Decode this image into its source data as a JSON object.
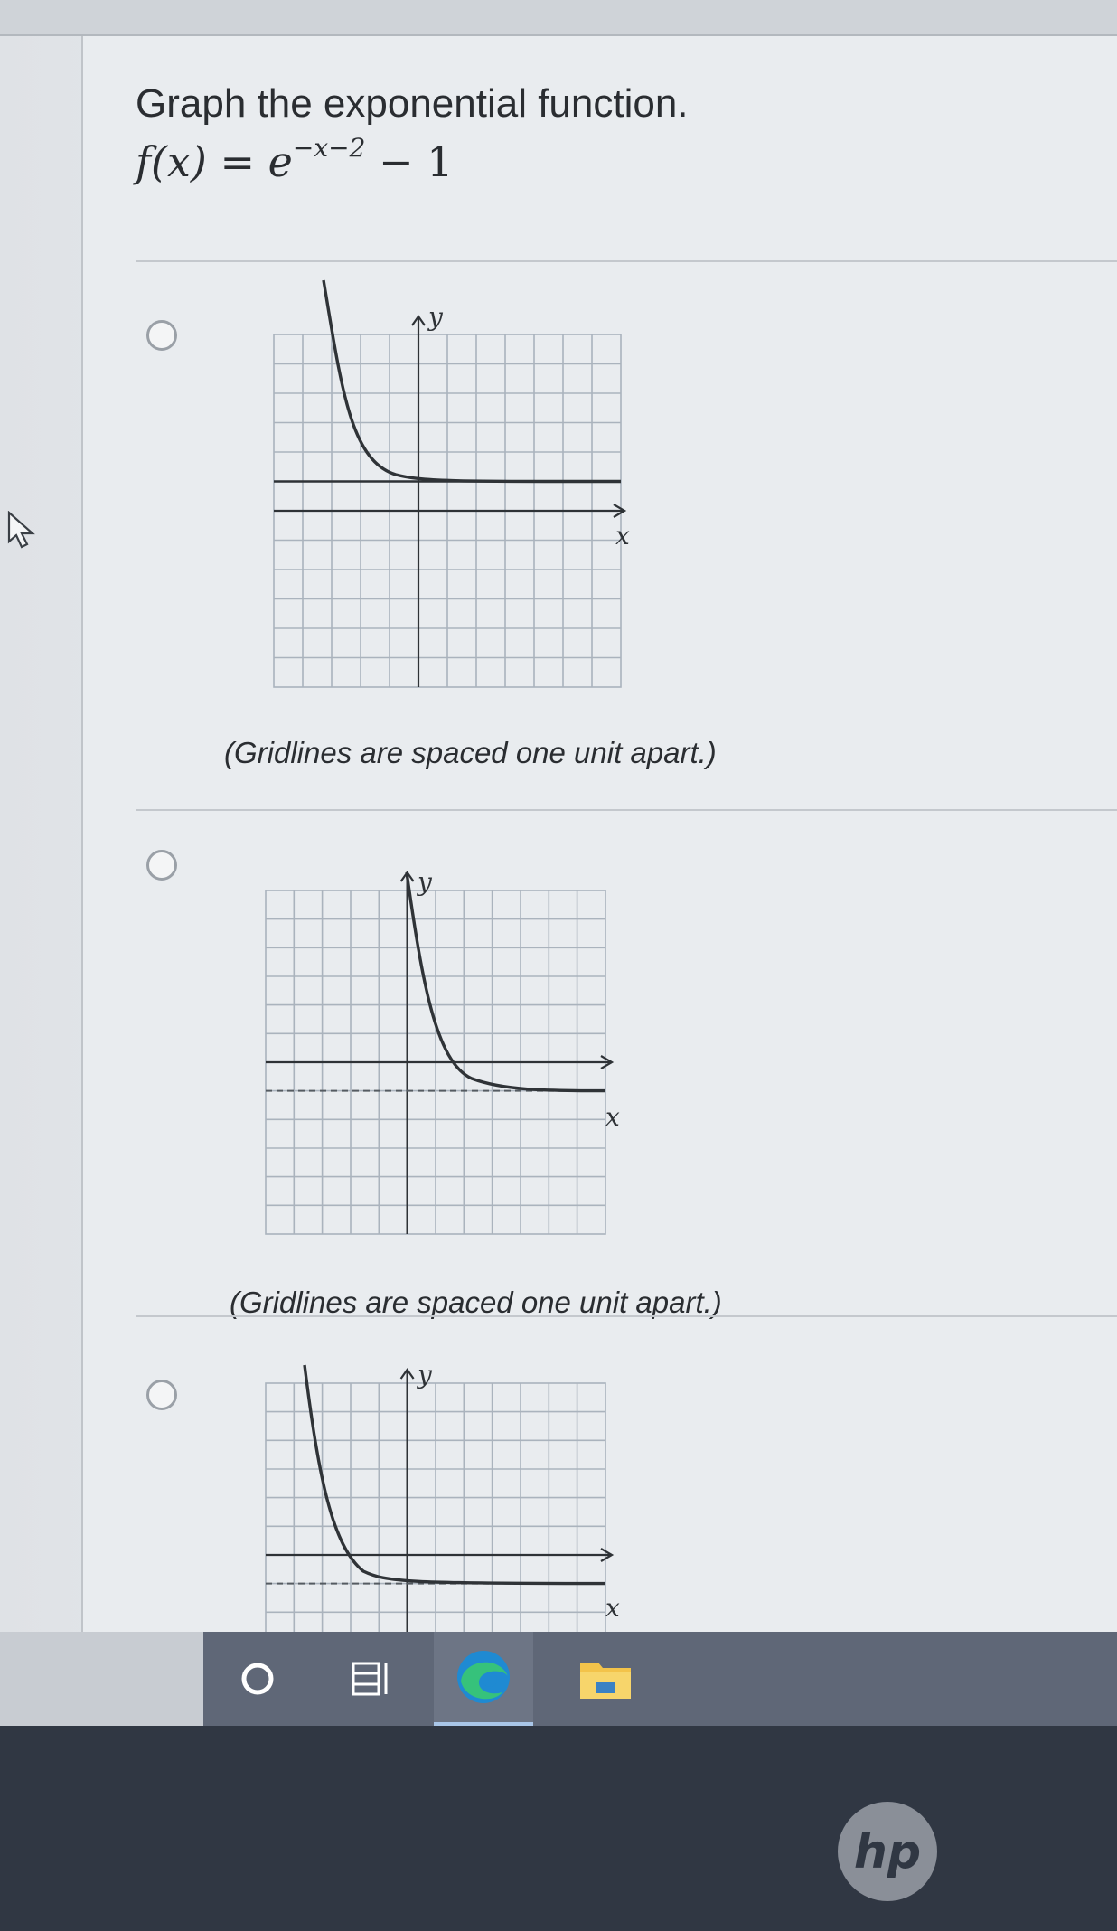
{
  "question": {
    "title": "Graph the exponential function.",
    "formula_prefix": "f(x) = e",
    "formula_exponent": "−x−2",
    "formula_suffix": " − 1"
  },
  "choices": [
    {
      "axis_x_label": "x",
      "axis_y_label": "y",
      "caption": "(Gridlines are spaced one unit apart.)",
      "selected": false
    },
    {
      "axis_x_label": "x",
      "axis_y_label": "y",
      "caption": "(Gridlines are spaced one unit apart.)",
      "selected": false
    },
    {
      "axis_x_label": "x",
      "axis_y_label": "y",
      "caption": "",
      "selected": false
    }
  ],
  "taskbar": {
    "items": [
      "search-icon",
      "task-view-icon",
      "edge-icon",
      "file-explorer-icon"
    ]
  },
  "device": {
    "brand_logo": "hp"
  },
  "colors": {
    "grid": "#aab3bd",
    "curve": "#2f3337",
    "taskbar": "#5f6777",
    "bezel": "#303743"
  }
}
